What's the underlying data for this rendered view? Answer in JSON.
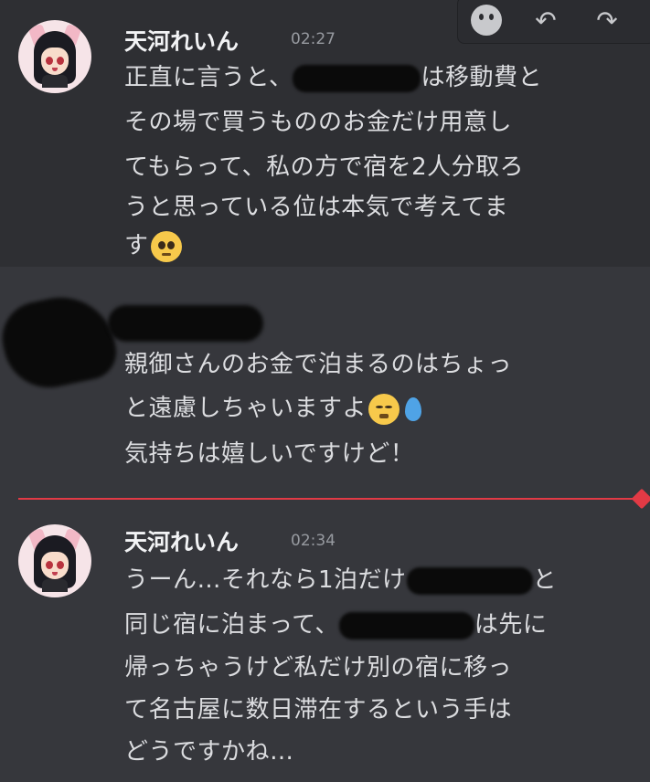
{
  "toolbar": {
    "icons": [
      "add-reaction-icon",
      "reply-icon",
      "forward-icon"
    ]
  },
  "messages": [
    {
      "username": "天河れいん",
      "time": "02:27",
      "lines": [
        {
          "before": "正直に言うと、",
          "after": "は移動費と"
        },
        {
          "text": "その場で買うもののお金だけ用意し"
        },
        {
          "text": "てもらって、私の方で宿を2人分取ろ"
        },
        {
          "text": "うと思っている位は本気で考えてま"
        },
        {
          "text": "す"
        }
      ],
      "emoji": "pleading-face"
    },
    {
      "lines": [
        {
          "text": "親御さんのお金で泊まるのはちょっ"
        },
        {
          "text": "と遠慮しちゃいますよ"
        },
        {
          "text": "気持ちは嬉しいですけど！"
        }
      ],
      "emoji": "confounded-face",
      "extra_emoji": "droplet"
    },
    {
      "username": "天河れいん",
      "time": "02:34",
      "lines": [
        {
          "before": "うーん…それなら1泊だけ",
          "after": "と"
        },
        {
          "before": "同じ宿に泊まって、",
          "after": "は先に"
        },
        {
          "text": "帰っちゃうけど私だけ別の宿に移っ"
        },
        {
          "text": "て名古屋に数日滞在するという手は"
        },
        {
          "text": "どうですかね…"
        }
      ]
    }
  ],
  "colors": {
    "background": "#36373c",
    "hover": "#2e2f33",
    "new_divider": "#e23a45",
    "text": "#dcdde0",
    "timestamp": "#979aa0"
  }
}
